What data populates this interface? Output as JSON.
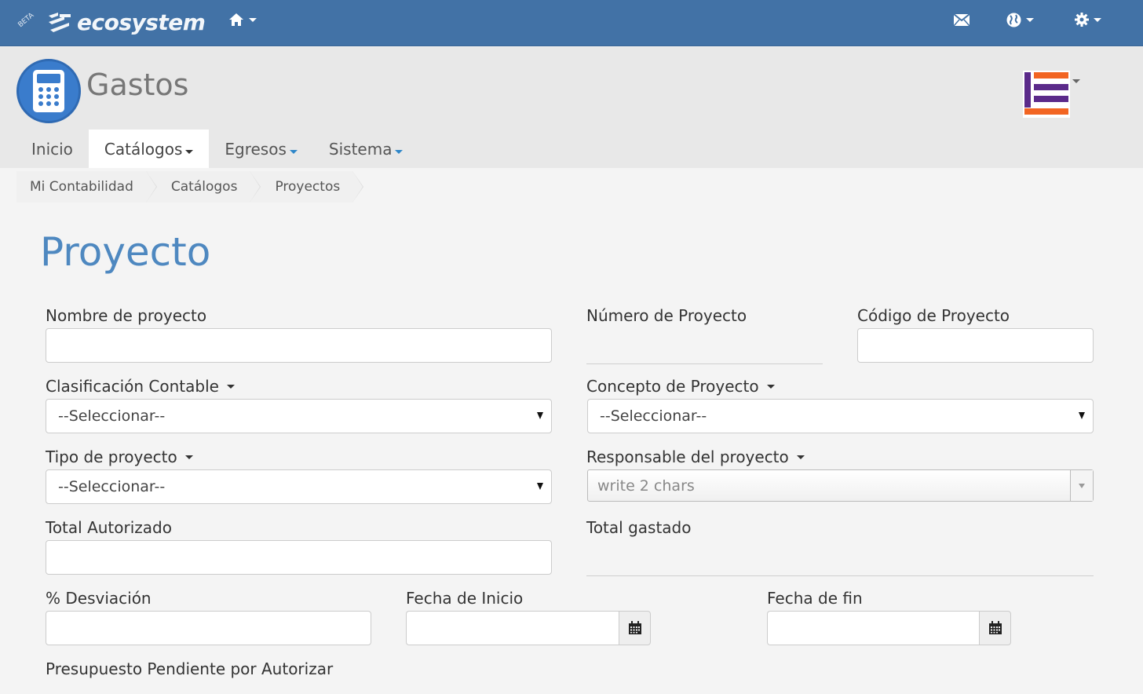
{
  "topbar": {
    "beta": "BETA",
    "logo_text": "ecosystem",
    "icons": [
      "home-icon",
      "mail-icon",
      "globe-icon",
      "gear-icon"
    ]
  },
  "app": {
    "title": "Gastos",
    "icon": "calculator-icon"
  },
  "tabs": [
    {
      "label": "Inicio",
      "active": false
    },
    {
      "label": "Catálogos",
      "active": true
    },
    {
      "label": "Egresos",
      "active": false
    },
    {
      "label": "Sistema",
      "active": false
    }
  ],
  "breadcrumb": [
    "Mi Contabilidad",
    "Catálogos",
    "Proyectos"
  ],
  "page_title": "Proyecto",
  "form": {
    "nombre_label": "Nombre de proyecto",
    "numero_label": "Número de Proyecto",
    "codigo_label": "Código de Proyecto",
    "clasificacion_label": "Clasificación Contable",
    "clasificacion_value": "--Seleccionar--",
    "concepto_label": "Concepto de Proyecto",
    "concepto_value": "--Seleccionar--",
    "tipo_label": "Tipo de proyecto",
    "tipo_value": "--Seleccionar--",
    "responsable_label": "Responsable del proyecto",
    "responsable_placeholder": "write 2 chars",
    "total_autorizado_label": "Total Autorizado",
    "total_gastado_label": "Total gastado",
    "desviacion_label": "% Desviación",
    "fecha_inicio_label": "Fecha de Inicio",
    "fecha_fin_label": "Fecha de fin",
    "presupuesto_label": "Presupuesto Pendiente por Autorizar"
  },
  "colors": {
    "topbar": "#4272a6",
    "accent": "#4e88c0",
    "header_bg": "#e8e8e8"
  }
}
